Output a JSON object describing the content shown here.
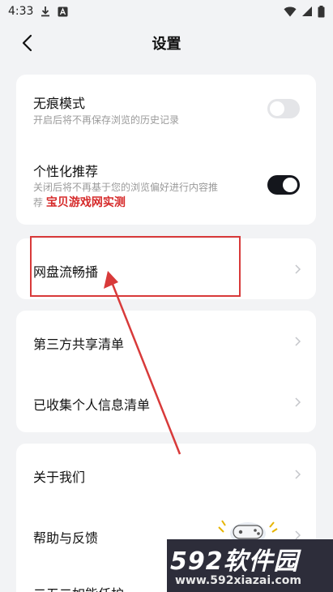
{
  "status_bar": {
    "time": "4:33"
  },
  "header": {
    "title": "设置"
  },
  "settings": {
    "incognito": {
      "title": "无痕模式",
      "subtitle": "开启后将不再保存浏览的历史记录",
      "enabled": false
    },
    "personalized": {
      "title": "个性化推荐",
      "subtitle_line1": "关闭后将不再基于您的浏览偏好进行内容推",
      "subtitle_line2": "荐",
      "enabled": true
    },
    "cloud_streaming": {
      "title": "网盘流畅播"
    },
    "third_party": {
      "title": "第三方共享清单"
    },
    "personal_info": {
      "title": "已收集个人信息清单"
    },
    "about": {
      "title": "关于我们"
    },
    "help": {
      "title": "帮助与反馈"
    },
    "partial": {
      "title": "二五二如能任护"
    }
  },
  "watermark": {
    "overlay_text": "宝贝游戏网实测",
    "logo_text": "592软件园",
    "logo_url": "www.592xiazai.com"
  },
  "colors": {
    "background": "#f2f3f5",
    "card": "#ffffff",
    "toggle_on": "#14161c",
    "toggle_off": "#e4e5e8",
    "annotation_red": "#d83a3a"
  }
}
